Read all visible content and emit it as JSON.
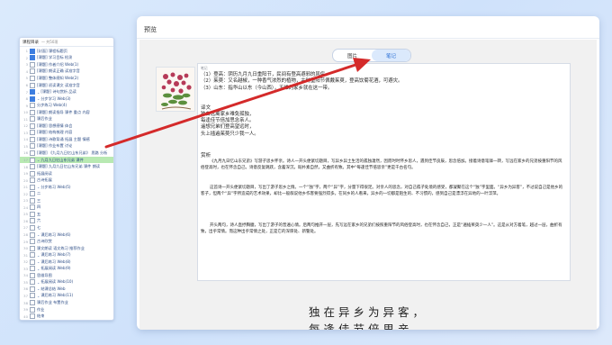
{
  "left_panel": {
    "title": "课程目录",
    "subtitle": "— 共50项",
    "rows": [
      {
        "n": "1",
        "label": "[封面] 课程标题页",
        "checked": true,
        "hl": false,
        "chev": false
      },
      {
        "n": "2",
        "label": "[课题] 学习目标 检测",
        "checked": true,
        "hl": false,
        "chev": false
      },
      {
        "n": "3",
        "label": "[课题] 作者介绍 Web(1)",
        "checked": false,
        "hl": false,
        "chev": false
      },
      {
        "n": "4",
        "label": "[课题] 朗读正确 读准字音",
        "checked": false,
        "hl": false,
        "chev": false
      },
      {
        "n": "5",
        "label": "[课题] 整体感知 Web(2)",
        "checked": false,
        "hl": false,
        "chev": false
      },
      {
        "n": "6",
        "label": "[课题] 初读课文 读准字音",
        "checked": false,
        "hl": false,
        "chev": false
      },
      {
        "n": "7",
        "label": "[课题] 诗句赏析 品读",
        "checked": true,
        "hl": false,
        "chev": true
      },
      {
        "n": "8",
        "label": "分步学习 Web(3)",
        "checked": true,
        "hl": false,
        "chev": true
      },
      {
        "n": "9",
        "label": "分步练习 Web(4)",
        "checked": false,
        "hl": false,
        "chev": false
      },
      {
        "n": "10",
        "label": "[课题] 朗读指导 课件 重点 内容",
        "checked": false,
        "hl": false,
        "chev": false
      },
      {
        "n": "11",
        "label": "课后作业",
        "checked": false,
        "hl": false,
        "chev": false
      },
      {
        "n": "12",
        "label": "[课题] 思想感情 体会",
        "checked": false,
        "hl": false,
        "chev": false
      },
      {
        "n": "13",
        "label": "[课题] 结构梳理 内容",
        "checked": false,
        "hl": false,
        "chev": false
      },
      {
        "n": "14",
        "label": "[课题] 诗歌背诵 拓展 主题 情感",
        "checked": false,
        "hl": false,
        "chev": false
      },
      {
        "n": "15",
        "label": "[课题] 作业布置 讨论",
        "checked": false,
        "hl": false,
        "chev": false
      },
      {
        "n": "16",
        "label": "[课题] 《九月九日忆山东兄弟》 思路 分析",
        "checked": false,
        "hl": false,
        "chev": false
      },
      {
        "n": "17",
        "label": "九月九日忆山东兄弟 课件",
        "checked": false,
        "hl": true,
        "chev": true
      },
      {
        "n": "18",
        "label": "[课题] 九月九日忆山东兄弟 课件 朗读",
        "checked": false,
        "hl": false,
        "chev": false
      },
      {
        "n": "19",
        "label": "拓展阅读",
        "checked": false,
        "hl": false,
        "chev": false
      },
      {
        "n": "20",
        "label": "古诗拓展",
        "checked": false,
        "hl": false,
        "chev": false
      },
      {
        "n": "21",
        "label": "分步练习 Web(5)",
        "checked": false,
        "hl": false,
        "chev": true
      },
      {
        "n": "22",
        "label": "二",
        "checked": false,
        "hl": false,
        "chev": false
      },
      {
        "n": "23",
        "label": "三",
        "checked": false,
        "hl": false,
        "chev": false
      },
      {
        "n": "24",
        "label": "四",
        "checked": false,
        "hl": false,
        "chev": false
      },
      {
        "n": "25",
        "label": "五",
        "checked": false,
        "hl": false,
        "chev": false
      },
      {
        "n": "26",
        "label": "六",
        "checked": false,
        "hl": false,
        "chev": false
      },
      {
        "n": "27",
        "label": "七",
        "checked": false,
        "hl": false,
        "chev": false
      },
      {
        "n": "28",
        "label": "课后练习 Web(6)",
        "checked": false,
        "hl": false,
        "chev": true
      },
      {
        "n": "29",
        "label": "古诗欣赏",
        "checked": false,
        "hl": false,
        "chev": false
      },
      {
        "n": "30",
        "label": "课文朗读 语文练习 推荐作业",
        "checked": false,
        "hl": false,
        "chev": false
      },
      {
        "n": "31",
        "label": "课后练习 Web(7)",
        "checked": false,
        "hl": false,
        "chev": true
      },
      {
        "n": "32",
        "label": "课后练习 Web(8)",
        "checked": false,
        "hl": false,
        "chev": true
      },
      {
        "n": "33",
        "label": "拓展阅读 Web(9)",
        "checked": false,
        "hl": false,
        "chev": true
      },
      {
        "n": "34",
        "label": "思维导图",
        "checked": false,
        "hl": false,
        "chev": false
      },
      {
        "n": "35",
        "label": "拓展阅读 Web(10)",
        "checked": false,
        "hl": false,
        "chev": true
      },
      {
        "n": "36",
        "label": "结课总结 Web",
        "checked": false,
        "hl": false,
        "chev": true
      },
      {
        "n": "37",
        "label": "课后练习 Web(11)",
        "checked": false,
        "hl": false,
        "chev": true
      },
      {
        "n": "38",
        "label": "课后作业 布置作业",
        "checked": false,
        "hl": false,
        "chev": false
      },
      {
        "n": "39",
        "label": "作业",
        "checked": false,
        "hl": false,
        "chev": false
      },
      {
        "n": "40",
        "label": "结束",
        "checked": false,
        "hl": false,
        "chev": false
      }
    ]
  },
  "main": {
    "title": "预览",
    "tabs": [
      "图片",
      "笔记"
    ],
    "active_tab": 1,
    "card_label": "笔记",
    "notes": [
      "（1）登高：阴历九月九日重阳节，民间有登高避邪的风俗。",
      "（2）茱萸：又名越椒，一种香气浓烈的植物，古时重阳节佩戴茱萸，登高饮菊花酒，可避灾。",
      "（3）山东：指华山以东（今山西），王维的家乡就在这一带。"
    ],
    "translation_title": "译文",
    "translation": [
      "独自远离家乡难免孤独，",
      "每逢佳节倍加思念亲人。",
      "遥想兄弟们登高望远时，",
      "头上插遍茱萸只少我一人。"
    ],
    "analysis_title": "赏析",
    "analysis": [
      "《九月九日忆山东兄弟》写游子思乡怀亲。诗人一开头便紧切题目，写异乡异土生活的孤独凄然，因而时时怀乡思人，遇到佳节良辰，思念倍加。接着诗意笔锋一转，写远在家乡的兄弟按重阳节的风俗登高时，也在怀念自己。诗意反复跳跃，含蓄深沉，既朴素自然，又曲折有致。其中“每逢佳节倍思亲”更是千古名句。",
      "这首诗一开头便紧切题目，写出了游子思乡之情。一个“独”字，两个“异”字，分量下得很足。对亲人的思念，对自己孤孑处境的感受，都凝聚在这个“独”字里面。“异乡为异客”，不过说自己是他乡的客子，但两个“异”字所造成的艺术效果，却比一般叙说他乡作客要强烈得多。在同乡的人看来，异乡的一切都是陌生的、不习惯的，感到自己是漂浮在异地的一叶浮萍。",
      "开头两句，诗人直抒胸臆，写出了游子的普遍心情。后两句推开一层，先写远在家乡的兄弟们按照重阳节的风俗登高时，也在怀念自己，正是“遍插茱萸少一人”。这是从对方着笔，越过一层，曲折有致，出乎常情。而这种出乎常情之处，正是它的深厚处、新警处。"
    ],
    "calligraphy": [
      "独在异乡为异客，",
      "每逢佳节倍思亲。"
    ]
  },
  "colors": {
    "accent": "#2a6fd6",
    "arrow": "#d42a2a",
    "highlight_row": "#b8e9b2",
    "background": "#d3e4fb"
  }
}
